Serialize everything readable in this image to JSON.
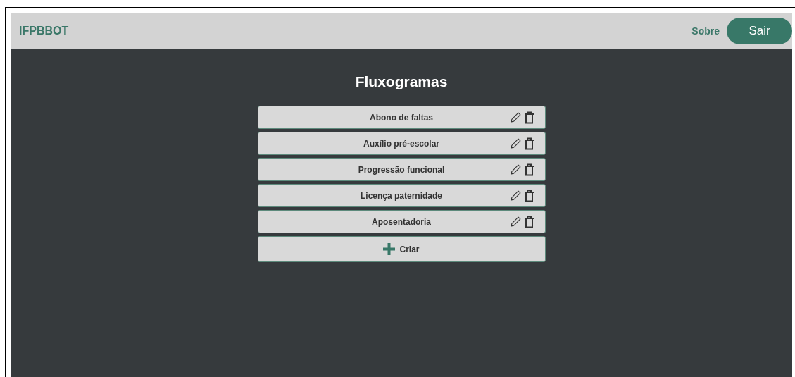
{
  "header": {
    "brand": "IFPBBOT",
    "links": [
      {
        "label": "Sobre",
        "kind": "link"
      },
      {
        "label": "Sair",
        "kind": "button"
      }
    ]
  },
  "title": "Fluxogramas",
  "flows": [
    {
      "name": "Abono de faltas"
    },
    {
      "name": "Auxílio pré-escolar"
    },
    {
      "name": "Progressão funcional"
    },
    {
      "name": "Licença paternidade"
    },
    {
      "name": "Aposentadoria"
    }
  ],
  "create_button": {
    "label": "Criar"
  }
}
